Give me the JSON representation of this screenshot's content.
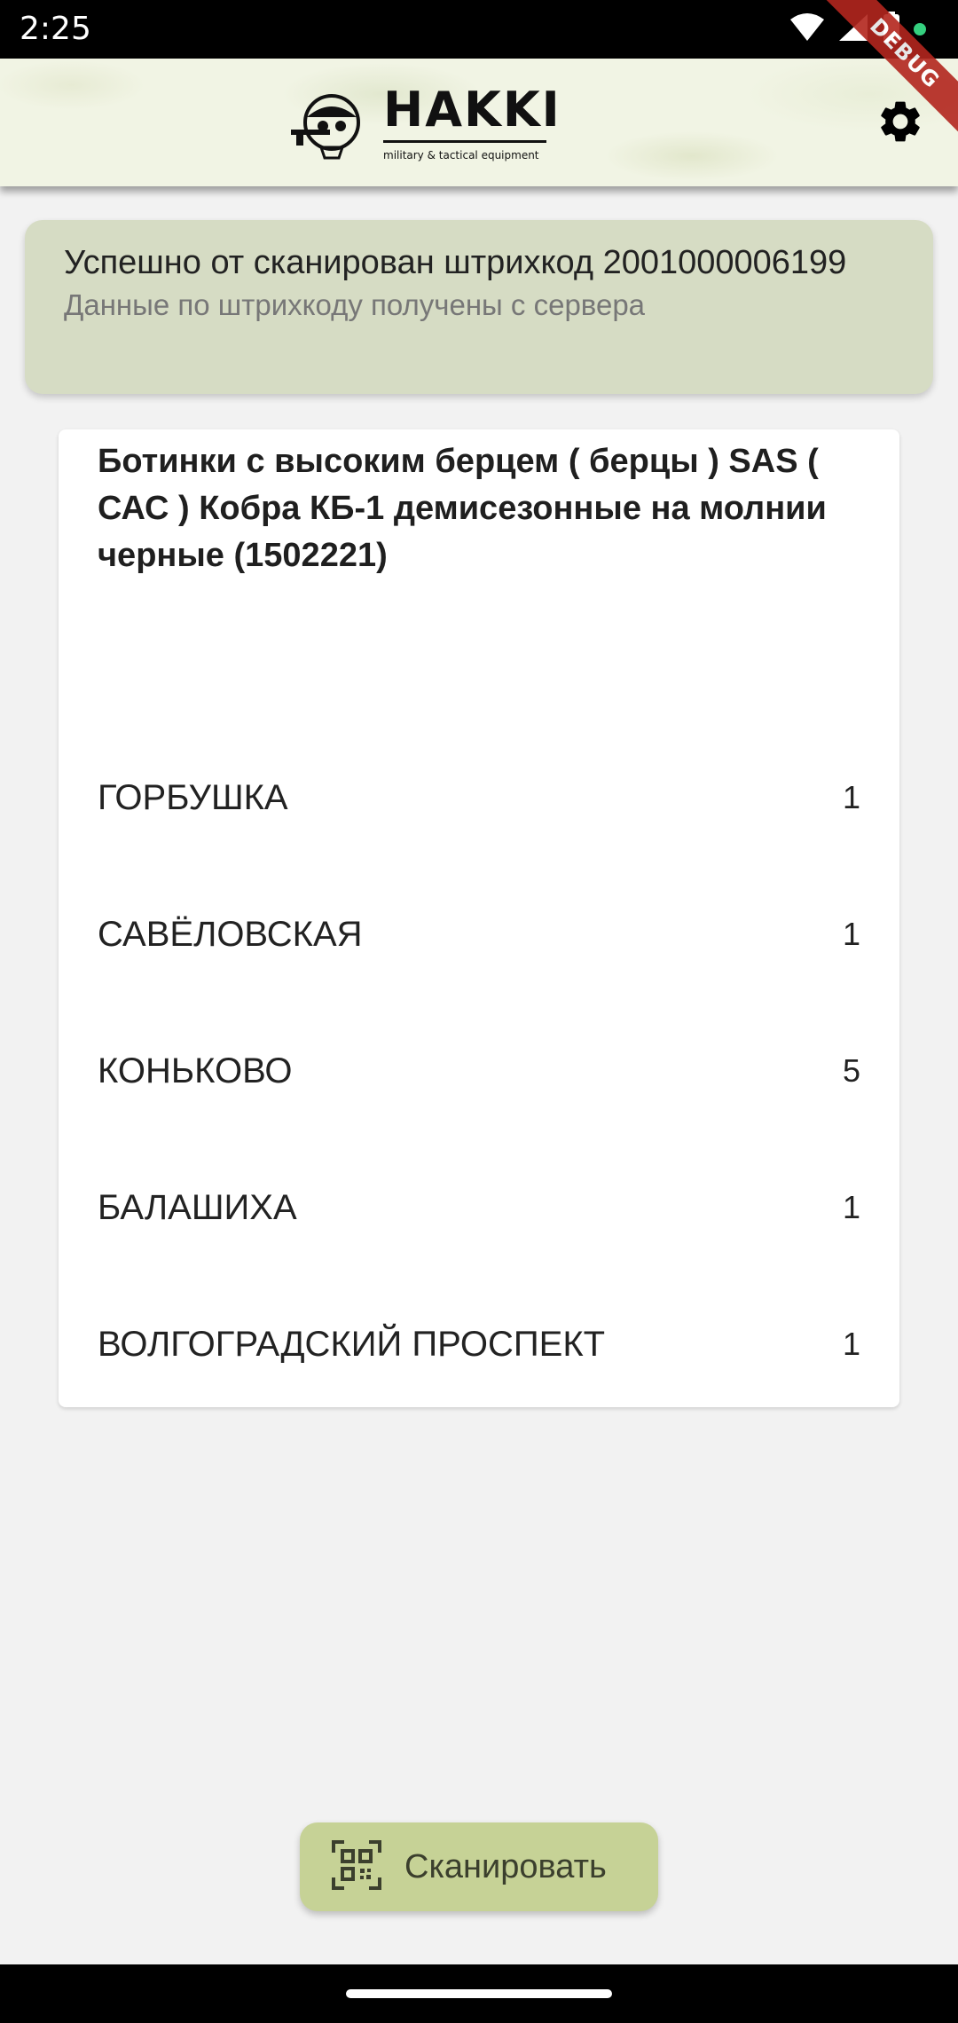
{
  "status_bar": {
    "time": "2:25",
    "icons": [
      "wifi-icon",
      "signal-icon",
      "battery-icon",
      "notification-dot-icon"
    ]
  },
  "debug_banner": "DEBUG",
  "app_bar": {
    "logo": {
      "title": "HAKKI",
      "subtitle": "military & tactical equipment"
    },
    "settings_icon": "gear-icon"
  },
  "scan_status": {
    "title": "Успешно от сканирован штрихкод 2001000006199",
    "subtitle": "Данные по штрихкоду получены с сервера",
    "background": "#d6dcc4"
  },
  "product": {
    "name": "Ботинки с высоким берцем ( берцы ) SAS ( САС ) Кобра КБ-1 демисезонные на молнии черные (1502221)",
    "stores": [
      {
        "name": "ГОРБУШКА",
        "qty": "1"
      },
      {
        "name": "САВЁЛОВСКАЯ",
        "qty": "1"
      },
      {
        "name": "КОНЬКОВО",
        "qty": "5"
      },
      {
        "name": "БАЛАШИХА",
        "qty": "1"
      },
      {
        "name": "ВОЛГОГРАДСКИЙ ПРОСПЕКТ",
        "qty": "1"
      }
    ]
  },
  "scan_button": {
    "label": "Сканировать",
    "icon": "qr-scan-icon",
    "color": "#c6d296"
  },
  "colors": {
    "debug_ribbon": "#b3261e",
    "status_dot": "#35d07f"
  }
}
